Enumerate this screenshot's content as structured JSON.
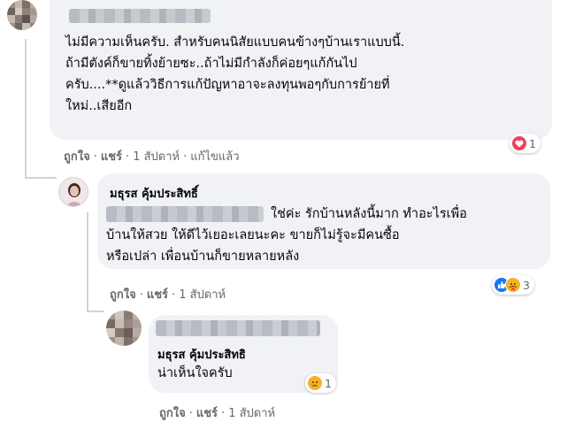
{
  "comment1": {
    "text_lines": [
      "ไม่มีความเห็นครับ. สำหรับคนนิสัยแบบคนข้างๆบ้านเราแบบนี้.",
      "ถ้ามีตังค์ก็ขายทิ้งย้ายซะ..ถ้าไม่มีกำลังก็ค่อยๆแก้กันไป",
      "ครับ....**ดูแล้ววิธีการแก้ปัญหาอาจะลงทุนพอๆกับการย้ายที่",
      "ใหม่..เสียอีก"
    ],
    "actions": {
      "like": "ถูกใจ",
      "share": "แชร์",
      "time": "1 สัปดาห์",
      "edited": "แก้ไขแล้ว"
    },
    "reactions": {
      "icons": [
        "heart-icon"
      ],
      "count": "1"
    }
  },
  "reply1": {
    "author": "มธุรส คุ้มประสิทธิ์",
    "text_line1": "ใช่ค่ะ รักบ้านหลังนี้มาก ทำอะไรเพื่อ",
    "text_lines": [
      "บ้านให้สวย ให้ดีไว้เยอะเลยนะคะ ขายก็ไม่รู้จะมีคนซื้อ",
      "หรือเปล่า เพื่อนบ้านก็ขายหลายหลัง"
    ],
    "actions": {
      "like": "ถูกใจ",
      "share": "แชร์",
      "time": "1 สัปดาห์"
    },
    "reactions": {
      "icons": [
        "like-icon",
        "care-icon"
      ],
      "count": "3"
    }
  },
  "reply2": {
    "author": "มธุรส คุ้มประสิทธิ",
    "text": "น่าเห็นใจครับ",
    "actions": {
      "like": "ถูกใจ",
      "share": "แชร์",
      "time": "1 สัปดาห์"
    },
    "reactions": {
      "icons": [
        "sad-icon"
      ],
      "count": "1"
    }
  },
  "colors": {
    "bubble": "#f0f2f5",
    "text": "#050505",
    "secondary": "#65676b",
    "like_blue": "#1877f2",
    "heart_red": "#f33e58",
    "emoji_yellow": "#f7b125"
  }
}
